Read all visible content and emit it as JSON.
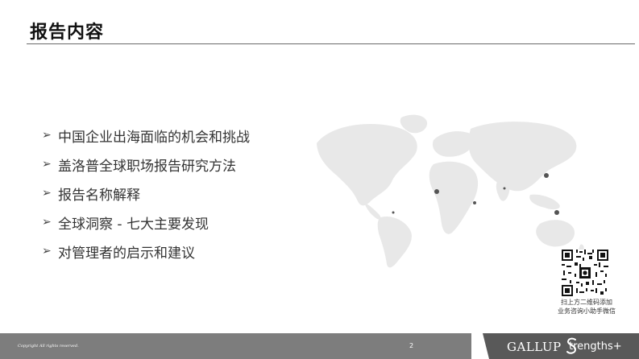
{
  "header": {
    "title": "报告内容"
  },
  "bullets": [
    "中国企业出海面临的机会和挑战",
    "盖洛普全球职场报告研究方法",
    "报告名称解释",
    "全球洞察 - 七大主要发现",
    "对管理者的启示和建议"
  ],
  "qr": {
    "caption_line1": "扫上方二维码添加",
    "caption_line2": "业务咨询小助手微信"
  },
  "footer": {
    "copyright": "Copyright All rights reserved.",
    "page_number": "2",
    "brand_gallup": "GALLUP",
    "brand_strengths": "trengths+"
  },
  "colors": {
    "footer_bar": "#7d7d7d",
    "footer_wedge": "#595959",
    "map": "#e8e8e8",
    "map_highlight": "#555555"
  },
  "icons": {
    "bullet": "triangle-arrow-right",
    "qr": "qr-code",
    "brand": "strengths-s-logo"
  }
}
